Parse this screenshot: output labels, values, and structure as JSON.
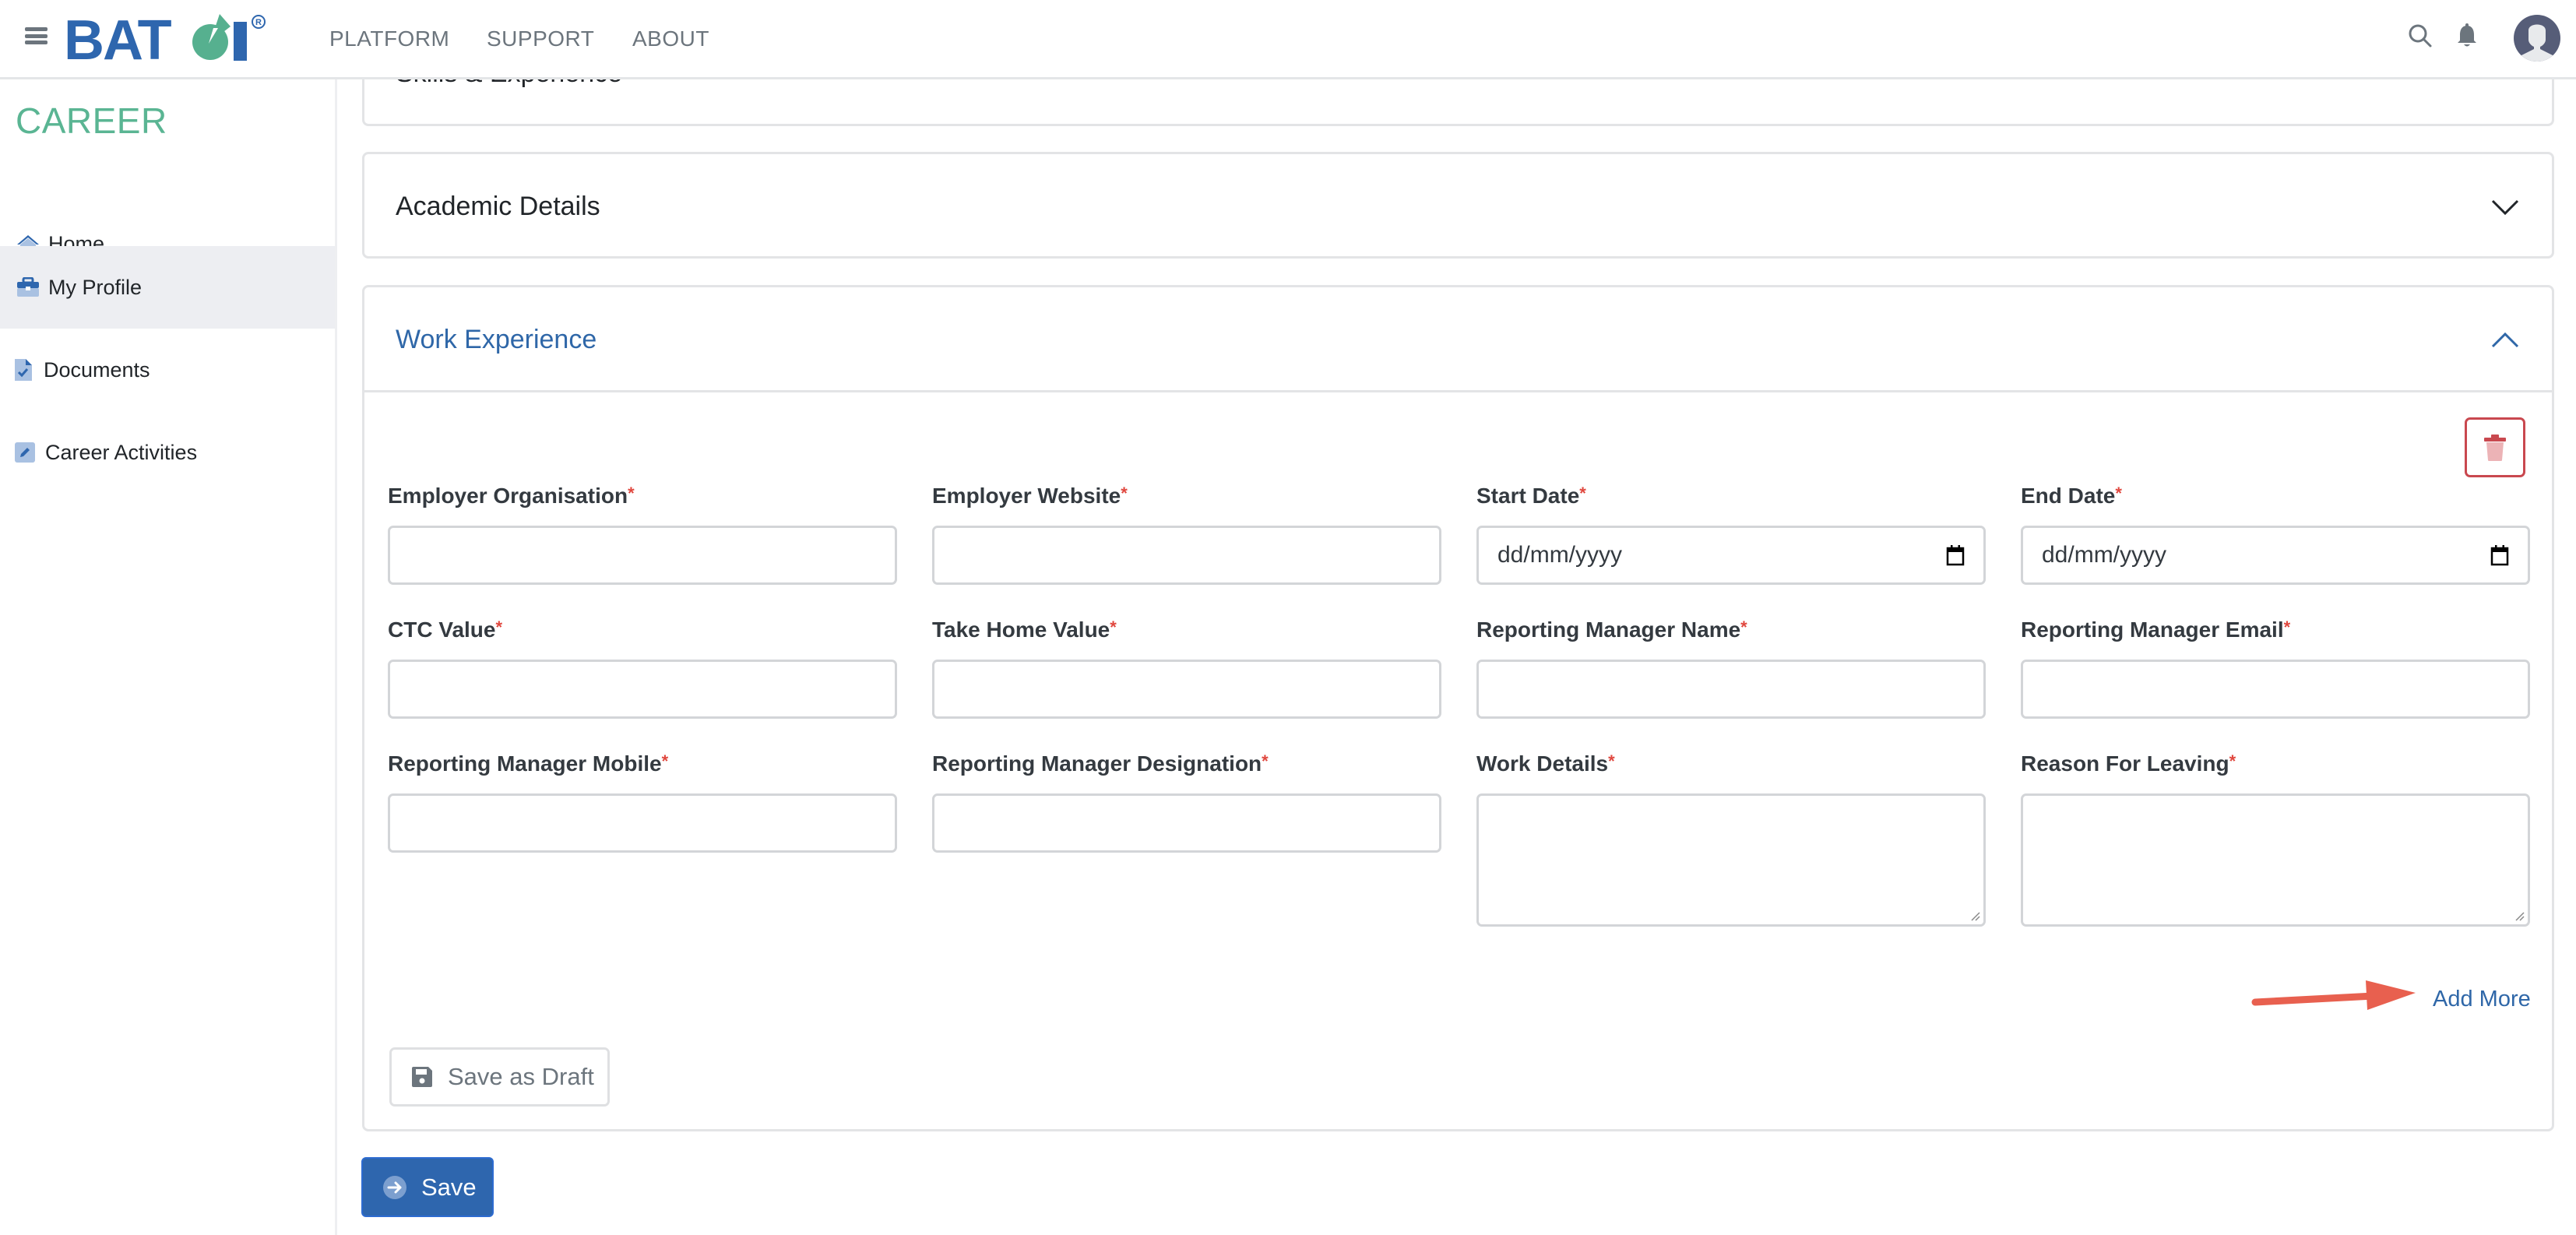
{
  "header": {
    "brand": "BATOI",
    "nav": [
      "PLATFORM",
      "SUPPORT",
      "ABOUT"
    ],
    "icons": [
      "hamburger-menu-icon",
      "search-icon",
      "bell-icon",
      "user-avatar-icon"
    ]
  },
  "sidebar": {
    "title": "CAREER",
    "items": [
      {
        "label": "Home",
        "icon": "home-icon",
        "active": false
      },
      {
        "label": "My Profile",
        "icon": "briefcase-icon",
        "active": true
      },
      {
        "label": "Documents",
        "icon": "document-check-icon",
        "active": false
      },
      {
        "label": "Career Activities",
        "icon": "edit-icon",
        "active": false
      }
    ]
  },
  "sections": {
    "skills": {
      "title": "Skills & Experience",
      "expanded": false
    },
    "academic": {
      "title": "Academic Details",
      "expanded": false
    },
    "work": {
      "title": "Work Experience",
      "expanded": true
    }
  },
  "work_form": {
    "required_marker": "*",
    "fields": [
      {
        "label": "Employer Organisation",
        "type": "text",
        "value": ""
      },
      {
        "label": "Employer Website",
        "type": "text",
        "value": ""
      },
      {
        "label": "Start Date",
        "type": "date",
        "value": "",
        "placeholder": "dd/mm/yyyy"
      },
      {
        "label": "End Date",
        "type": "date",
        "value": "",
        "placeholder": "dd/mm/yyyy"
      },
      {
        "label": "CTC Value",
        "type": "text",
        "value": ""
      },
      {
        "label": "Take Home Value",
        "type": "text",
        "value": ""
      },
      {
        "label": "Reporting Manager Name",
        "type": "text",
        "value": ""
      },
      {
        "label": "Reporting Manager Email",
        "type": "text",
        "value": ""
      },
      {
        "label": "Reporting Manager Mobile",
        "type": "text",
        "value": ""
      },
      {
        "label": "Reporting Manager Designation",
        "type": "text",
        "value": ""
      },
      {
        "label": "Work Details",
        "type": "textarea",
        "value": ""
      },
      {
        "label": "Reason For Leaving",
        "type": "textarea",
        "value": ""
      }
    ],
    "add_more_label": "Add More",
    "save_draft_label": "Save as Draft"
  },
  "save_label": "Save",
  "colors": {
    "brand_blue": "#2f67a8",
    "brand_green": "#5ab593",
    "danger": "#c9484f",
    "annotation_arrow": "#e8604f"
  }
}
